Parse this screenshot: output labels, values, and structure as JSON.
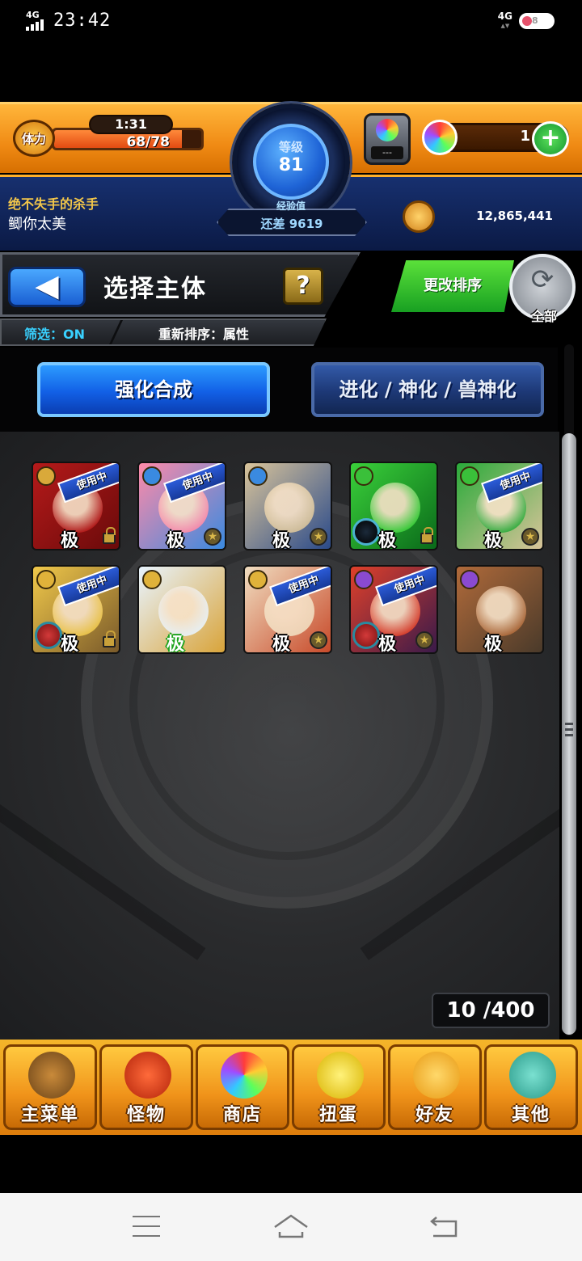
{
  "status_bar": {
    "network": "4G",
    "time": "23:42",
    "network_right": "4G",
    "battery": "8"
  },
  "header": {
    "stamina_label": "体力",
    "stamina_timer": "1:31",
    "stamina_value": "68/78",
    "stamina_fraction": 0.87,
    "level_label": "等级",
    "level_value": "81",
    "exp_label": "经验值",
    "exp_remaining": "还差 9619",
    "player_title": "绝不失手的杀手",
    "player_name": "鲫你太美",
    "orb_box_text": "---",
    "orb_count": "1",
    "plus_label": "+",
    "coins": "12,865,441"
  },
  "title_bar": {
    "back_icon": "left-arrow-icon",
    "title": "选择主体",
    "help_label": "?",
    "filter_text": "筛选：ON",
    "sort_text": "重新排序：属性",
    "change_sort_label": "更改排序",
    "all_label": "全部"
  },
  "tabs": [
    {
      "label": "强化合成",
      "active": true
    },
    {
      "label": "进化 / 神化 / 兽神化",
      "active": false
    }
  ],
  "monsters": [
    {
      "rank": "极",
      "in_use": "使用中",
      "attr": "fire",
      "colors": [
        "#b51a1a",
        "#6a0a0a"
      ]
    },
    {
      "rank": "极",
      "in_use": "使用中",
      "attr": "water",
      "colors": [
        "#ff8aa8",
        "#3a8ae0"
      ]
    },
    {
      "rank": "极",
      "in_use": "",
      "attr": "water",
      "colors": [
        "#d9c49a",
        "#2a4a8a"
      ]
    },
    {
      "rank": "极",
      "in_use": "",
      "attr": "wood",
      "colors": [
        "#3ad03a",
        "#0a6a1a"
      ]
    },
    {
      "rank": "极",
      "in_use": "使用中",
      "attr": "wood",
      "colors": [
        "#2aaa3a",
        "#d9c49a"
      ]
    },
    {
      "rank": "极",
      "in_use": "使用中",
      "attr": "light",
      "colors": [
        "#f0c84a",
        "#7a5a2a"
      ]
    },
    {
      "rank": "极",
      "in_use": "",
      "attr": "light",
      "colors": [
        "#e8f4ff",
        "#d9a43a"
      ]
    },
    {
      "rank": "极",
      "in_use": "使用中",
      "attr": "light",
      "colors": [
        "#f0ddc0",
        "#c84a2a"
      ]
    },
    {
      "rank": "极",
      "in_use": "使用中",
      "attr": "dark",
      "colors": [
        "#e0402a",
        "#3a1a4a"
      ]
    },
    {
      "rank": "极",
      "in_use": "",
      "attr": "dark",
      "colors": [
        "#b06a3a",
        "#4a3a2a"
      ]
    }
  ],
  "box_count": "10 /400",
  "bottom_menu": [
    {
      "label": "主菜单",
      "icon": "home-gate-icon"
    },
    {
      "label": "怪物",
      "icon": "monster-icon"
    },
    {
      "label": "商店",
      "icon": "orb-icon"
    },
    {
      "label": "扭蛋",
      "icon": "egg-icon"
    },
    {
      "label": "好友",
      "icon": "friends-icon"
    },
    {
      "label": "其他",
      "icon": "question-icon"
    }
  ],
  "colors": {
    "orange": "#f08a14",
    "blue_tab": "#1260e6",
    "green_button": "#18a022"
  }
}
